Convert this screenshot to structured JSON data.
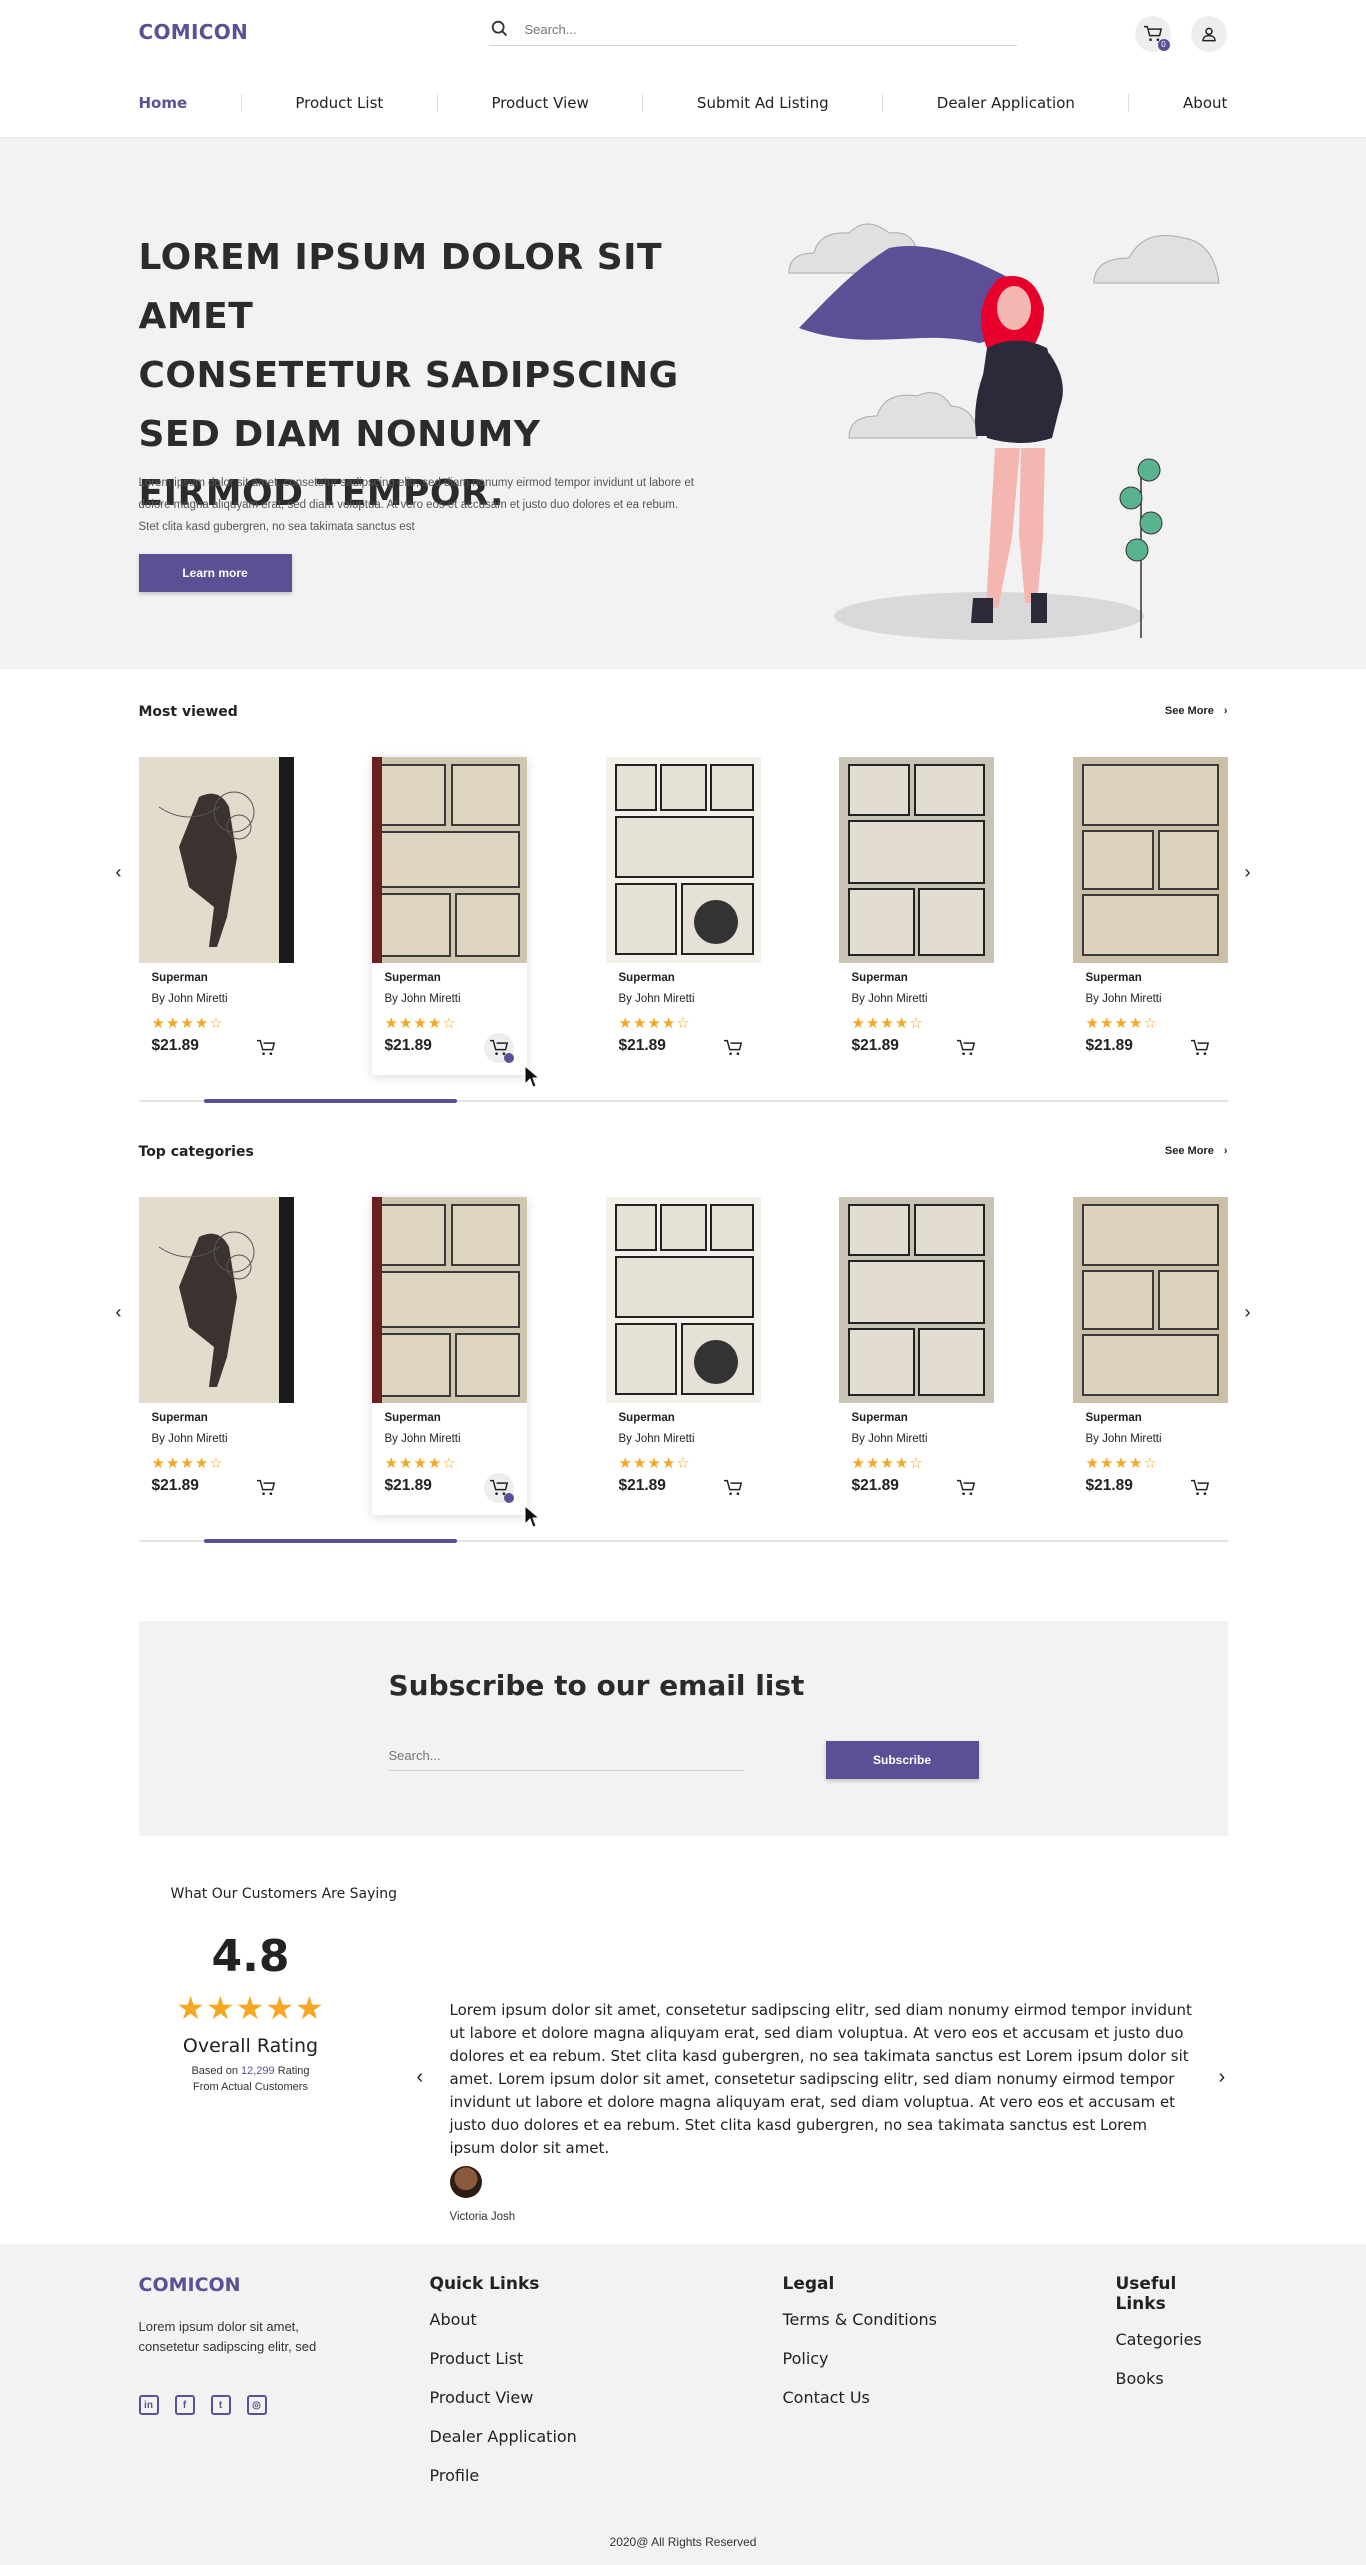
{
  "header": {
    "logo": "COMICON",
    "search_placeholder": "Search...",
    "cart_badge": "0"
  },
  "nav": {
    "items": [
      "Home",
      "Product List",
      "Product View",
      "Submit Ad Listing",
      "Dealer Application",
      "About"
    ],
    "active": "Home"
  },
  "hero": {
    "title_lines": [
      "LOREM IPSUM DOLOR SIT AMET",
      "CONSETETUR SADIPSCING",
      "SED DIAM NONUMY",
      "EIRMOD TEMPOR."
    ],
    "body": "Lorem ipsum dolor sit amet, consetetur sadipscing elitr, sed diam nonumy eirmod tempor invidunt ut labore et dolore magna aliquyam erat, sed diam voluptua. At vero eos et accusam et justo duo dolores et ea rebum. Stet clita kasd gubergren, no sea takimata sanctus est",
    "button": "Learn more"
  },
  "sections": [
    {
      "title": "Most viewed",
      "see_more": "See More",
      "products": [
        {
          "name": "Superman",
          "author": "By John Miretti",
          "stars": "★★★★☆",
          "price": "$21.89"
        },
        {
          "name": "Superman",
          "author": "By John Miretti",
          "stars": "★★★★☆",
          "price": "$21.89"
        },
        {
          "name": "Superman",
          "author": "By John Miretti",
          "stars": "★★★★☆",
          "price": "$21.89"
        },
        {
          "name": "Superman",
          "author": "By John Miretti",
          "stars": "★★★★☆",
          "price": "$21.89"
        },
        {
          "name": "Superman",
          "author": "By John Miretti",
          "stars": "★★★★☆",
          "price": "$21.89"
        }
      ]
    },
    {
      "title": "Top categories",
      "see_more": "See More",
      "products": [
        {
          "name": "Superman",
          "author": "By John Miretti",
          "stars": "★★★★☆",
          "price": "$21.89"
        },
        {
          "name": "Superman",
          "author": "By John Miretti",
          "stars": "★★★★☆",
          "price": "$21.89"
        },
        {
          "name": "Superman",
          "author": "By John Miretti",
          "stars": "★★★★☆",
          "price": "$21.89"
        },
        {
          "name": "Superman",
          "author": "By John Miretti",
          "stars": "★★★★☆",
          "price": "$21.89"
        },
        {
          "name": "Superman",
          "author": "By John Miretti",
          "stars": "★★★★☆",
          "price": "$21.89"
        }
      ]
    }
  ],
  "subscribe": {
    "title": "Subscribe to our email list",
    "placeholder": "Search...",
    "button": "Subscribe"
  },
  "testimonials": {
    "heading": "What Our Customers Are Saying",
    "score": "4.8",
    "stars": "★★★★★",
    "overall_label": "Overall Rating",
    "based_prefix": "Based on",
    "based_count": "12,299",
    "based_suffix": "Rating",
    "based_line2": "From Actual Customers",
    "quote": "Lorem ipsum dolor sit amet, consetetur sadipscing elitr, sed diam nonumy eirmod tempor invidunt ut labore et dolore magna aliquyam erat, sed diam voluptua. At vero eos et accusam et justo duo dolores et ea rebum. Stet clita kasd gubergren, no sea takimata sanctus est Lorem ipsum dolor sit amet. Lorem ipsum dolor sit amet, consetetur sadipscing elitr, sed diam nonumy eirmod tempor invidunt ut labore et dolore magna aliquyam erat, sed diam voluptua. At vero eos et accusam et justo duo dolores et ea rebum. Stet clita kasd gubergren, no sea takimata sanctus est Lorem ipsum dolor sit amet.",
    "author": "Victoria Josh"
  },
  "footer": {
    "logo": "COMICON",
    "description": "Lorem ipsum dolor sit amet, consetetur sadipscing elitr, sed",
    "social": [
      "linkedin-icon",
      "facebook-icon",
      "twitter-icon",
      "instagram-icon"
    ],
    "quick_links_title": "Quick Links",
    "quick_links": [
      "About",
      "Product List",
      "Product View",
      "Dealer Application",
      "Profile"
    ],
    "legal_title": "Legal",
    "legal_links": [
      "Terms & Conditions",
      "Policy",
      "Contact Us"
    ],
    "useful_title": "Useful Links",
    "useful_links": [
      "Categories",
      "Books"
    ],
    "copyright": "2020@ All Rights Reserved"
  },
  "colors": {
    "brand": "#5d4f96",
    "star": "#f5a623",
    "panel": "#f2f2f2"
  }
}
